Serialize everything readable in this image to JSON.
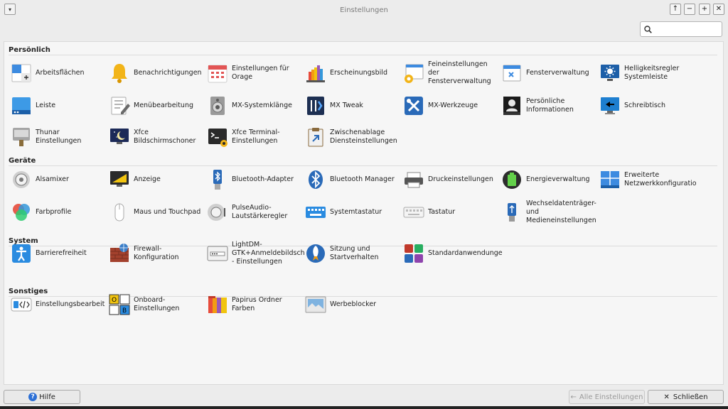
{
  "window": {
    "title": "Einstellungen",
    "menu_glyph": "▾",
    "controls": [
      "↑",
      "−",
      "+",
      "✕"
    ]
  },
  "search": {
    "value": "",
    "placeholder": ""
  },
  "sections": {
    "personal": "Persönlich",
    "hardware": "Geräte",
    "system": "System",
    "other": "Sonstiges"
  },
  "items": [
    {
      "label": "Arbeitsflächen",
      "icon": "workspaces-icon"
    },
    {
      "label": "Benachrichtigungen",
      "icon": "bell-icon"
    },
    {
      "label": "Einstellungen für\nOrage",
      "icon": "calendar-icon"
    },
    {
      "label": "Erscheinungsbild",
      "icon": "palette-icon"
    },
    {
      "label": "Feineinstellungen\nder\nFensterverwaltung",
      "icon": "window-tweaks-icon"
    },
    {
      "label": "Fensterverwaltung",
      "icon": "window-manager-icon"
    },
    {
      "label": "Helligkeitsregler\nSystemleiste",
      "icon": "brightness-icon"
    },
    {
      "label": "Leiste",
      "icon": "panel-icon"
    },
    {
      "label": "Menübearbeitung",
      "icon": "menu-editor-icon"
    },
    {
      "label": "MX-Systemklänge",
      "icon": "speaker-icon"
    },
    {
      "label": "MX Tweak",
      "icon": "mx-tweak-icon"
    },
    {
      "label": "MX-Werkzeuge",
      "icon": "tools-icon"
    },
    {
      "label": "Persönliche\nInformationen",
      "icon": "id-card-icon"
    },
    {
      "label": "Schreibtisch",
      "icon": "desktop-icon"
    },
    {
      "label": "Thunar\nEinstellungen",
      "icon": "thunar-icon"
    },
    {
      "label": "Xfce\nBildschirmschoner",
      "icon": "screensaver-icon"
    },
    {
      "label": "Xfce Terminal-\nEinstellungen",
      "icon": "terminal-icon"
    },
    {
      "label": "Zwischenablage\nDiensteinstellungen",
      "icon": "clipboard-icon"
    },
    {
      "label": "Alsamixer",
      "icon": "mixer-icon"
    },
    {
      "label": "Anzeige",
      "icon": "display-icon"
    },
    {
      "label": "Bluetooth-Adapter",
      "icon": "bluetooth-adapter-icon"
    },
    {
      "label": "Bluetooth Manager",
      "icon": "bluetooth-icon"
    },
    {
      "label": "Druckeinstellungen",
      "icon": "printer-icon"
    },
    {
      "label": "Energieverwaltung",
      "icon": "battery-icon"
    },
    {
      "label": "Erweiterte\nNetzwerkkonfiguratio",
      "icon": "network-icon"
    },
    {
      "label": "Farbprofile",
      "icon": "color-profile-icon"
    },
    {
      "label": "Maus und Touchpad",
      "icon": "mouse-icon"
    },
    {
      "label": "PulseAudio-\nLautstärkeregler",
      "icon": "pulseaudio-icon"
    },
    {
      "label": "Systemtastatur",
      "icon": "keyboard-blue-icon"
    },
    {
      "label": "Tastatur",
      "icon": "keyboard-icon"
    },
    {
      "label": "Wechseldatenträger-\nund\nMedieneinstellungen",
      "icon": "usb-icon"
    },
    {
      "label": "Barrierefreiheit",
      "icon": "accessibility-icon"
    },
    {
      "label": "Firewall-\nKonfiguration",
      "icon": "firewall-icon"
    },
    {
      "label": "LightDM-\nGTK+Anmeldebildsch\n- Einstellungen",
      "icon": "login-icon"
    },
    {
      "label": "Sitzung und\nStartverhalten",
      "icon": "rocket-icon"
    },
    {
      "label": "Standardanwendunge",
      "icon": "default-apps-icon"
    },
    {
      "label": "Einstellungsbearbeit",
      "icon": "settings-editor-icon"
    },
    {
      "label": "Onboard-\nEinstellungen",
      "icon": "onboard-keyboard-icon"
    },
    {
      "label": "Papirus Ordner\nFarben",
      "icon": "folder-colors-icon"
    },
    {
      "label": "Werbeblocker",
      "icon": "adblock-icon"
    }
  ],
  "footer": {
    "help": "Hilfe",
    "help_glyph": "?",
    "all_settings": "Alle Einstellungen",
    "all_settings_glyph": "←",
    "close": "Schließen",
    "close_glyph": "✕"
  }
}
